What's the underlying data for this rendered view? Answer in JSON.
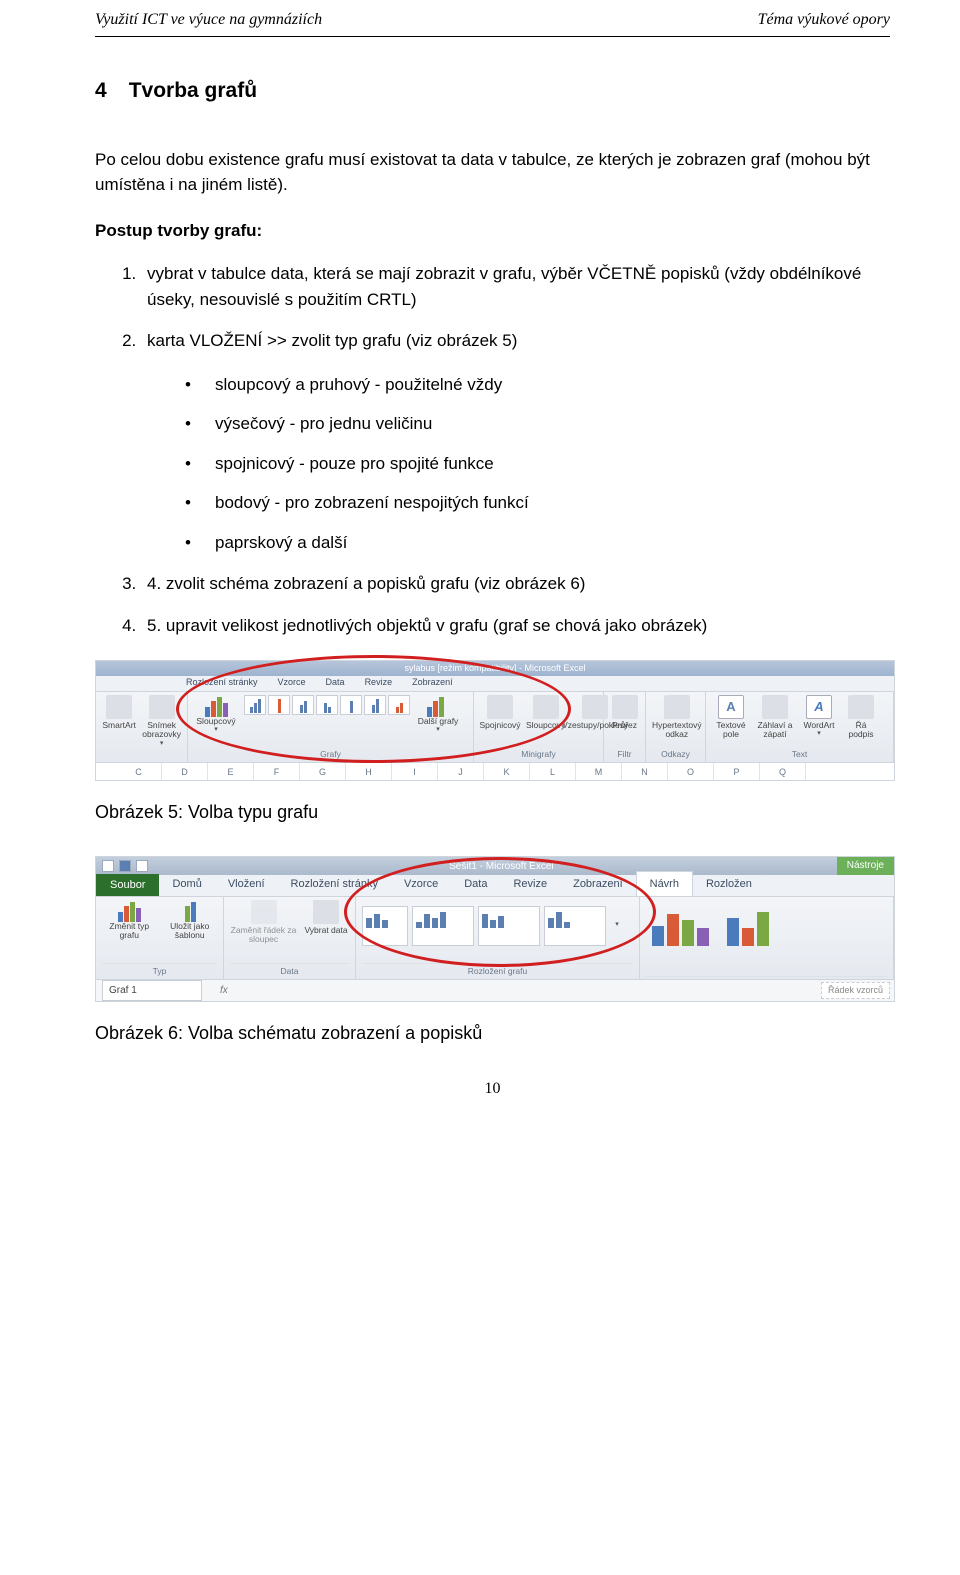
{
  "header": {
    "left": "Využití ICT ve výuce na gymnáziích",
    "right": "Téma výukové opory"
  },
  "heading": {
    "number": "4",
    "text": "Tvorba grafů"
  },
  "p1": "Po celou dobu existence grafu musí existovat ta data v tabulce, ze kterých je zobrazen graf (mohou být umístěna i na jiném listě).",
  "p_bold": "Postup tvorby grafu:",
  "ol": {
    "i1": "vybrat v tabulce data, která se mají zobrazit v grafu, výběr VČETNĚ popisků (vždy obdélníkové úseky, nesouvislé s použitím CRTL)",
    "i2": "karta VLOŽENÍ  >> zvolit typ grafu (viz obrázek 5)",
    "sub": {
      "s1": "sloupcový a pruhový - použitelné vždy",
      "s2": "výsečový - pro jednu veličinu",
      "s3": "spojnicový - pouze pro spojité funkce",
      "s4": "bodový - pro zobrazení nespojitých funkcí",
      "s5": "paprskový a další"
    },
    "i3": "4. zvolit schéma zobrazení a popisků grafu (viz obrázek 6)",
    "i4": "5. upravit velikost jednotlivých objektů v grafu (graf se chová jako obrázek)"
  },
  "caption1": "Obrázek 5: Volba typu grafu",
  "caption2": "Obrázek 6: Volba schématu zobrazení a popisků",
  "pagenum": "10",
  "shot1": {
    "title": "sylabus [režim kompatibility] - Microsoft Excel",
    "tabs": [
      "Rozložení stránky",
      "Vzorce",
      "Data",
      "Revize",
      "Zobrazení"
    ],
    "groups": {
      "g1": {
        "label": "",
        "btns": [
          "SmartArt",
          "Snímek\nobrazovky"
        ]
      },
      "charts": {
        "label": "Grafy",
        "btns": [
          "Sloupcový"
        ],
        "more": "Další\ngrafy"
      },
      "mini": {
        "label": "Minigrafy",
        "btns": [
          "Spojnicový",
          "Sloupcový",
          "Vzestupy/poklesy"
        ]
      },
      "filter": {
        "label": "Filtr",
        "btns": [
          "Průřez"
        ]
      },
      "links": {
        "label": "Odkazy",
        "btns": [
          "Hypertextový\nodkaz"
        ]
      },
      "text": {
        "label": "Text",
        "btns": [
          "Textové\npole",
          "Záhlaví\na zápatí",
          "WordArt",
          "Řá\npodpis"
        ]
      }
    },
    "cols": [
      "C",
      "D",
      "E",
      "F",
      "G",
      "H",
      "I",
      "J",
      "K",
      "L",
      "M",
      "N",
      "O",
      "P",
      "Q"
    ]
  },
  "shot2": {
    "title": "Sešit1 - Microsoft Excel",
    "tools": "Nástroje",
    "tabs": {
      "file": "Soubor",
      "items": [
        "Domů",
        "Vložení",
        "Rozložení stránky",
        "Vzorce",
        "Data",
        "Revize",
        "Zobrazení",
        "Návrh",
        "Rozložen"
      ]
    },
    "groups": {
      "type": {
        "label": "Typ",
        "btns": [
          "Změnit\ntyp grafu",
          "Uložit jako\nšablonu"
        ]
      },
      "data": {
        "label": "Data",
        "btns": [
          "Zaměnit řádek\nza sloupec",
          "Vybrat\ndata"
        ]
      },
      "layout": {
        "label": "Rozložení grafu"
      },
      "styles": {
        "label": ""
      }
    },
    "namebox": "Graf 1",
    "fx": "fx",
    "hint": "Řádek vzorců"
  }
}
